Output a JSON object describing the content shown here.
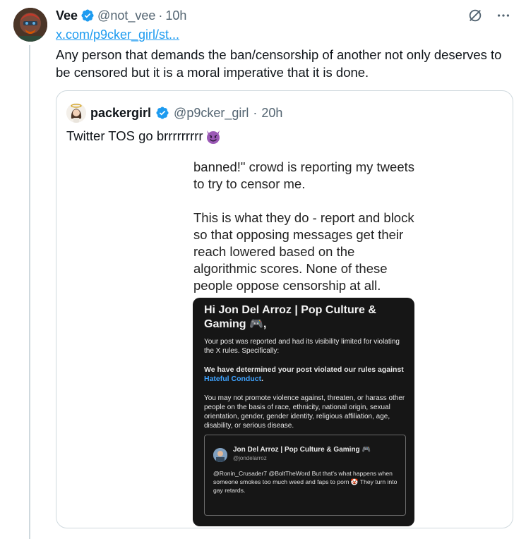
{
  "post": {
    "author_name": "Vee",
    "author_handle": "@not_vee",
    "separator": "·",
    "time": "10h",
    "link_text": "x.com/p9cker_girl/st...",
    "text": "Any person that demands the ban/censorship of another not only deserves to be censored but it is a moral imperative that it is done."
  },
  "quote": {
    "author_name": "packergirl",
    "author_handle": "@p9cker_girl",
    "separator": "·",
    "time": "20h",
    "text": "Twitter TOS go brrrrrrrrr",
    "media": {
      "paragraph1": "banned!\" crowd is reporting my tweets to try to censor me.",
      "paragraph2": "This is what they do - report and block so that opposing messages get their reach lowered based on the algorithmic scores. None of these people oppose censorship at all.",
      "notice": {
        "title": "Hi Jon Del Arroz | Pop Culture & Gaming 🎮,",
        "line1": "Your post was reported and had its visibility limited for violating the X rules. Specifically:",
        "line2_pre": "We have determined your post violated our rules against ",
        "line2_link": "Hateful Conduct",
        "line2_post": ".",
        "line3": "You may not promote violence against, threaten, or harass other people on the basis of race, ethnicity, national origin, sexual orientation, gender, gender identity, religious affiliation, age, disability, or serious disease.",
        "inner_tweet": {
          "name": "Jon Del Arroz | Pop Culture & Gaming 🎮",
          "handle": "@jondelarroz",
          "body": "@Ronin_Crusader7 @BoltTheWord But that's what happens when someone smokes too much weed and faps to porn 🤡 They turn into gay retards."
        }
      }
    }
  },
  "icons": {
    "verified": "verified-badge-icon",
    "grok": "grok-icon",
    "more": "more-icon",
    "devil": "smiling-devil-emoji"
  },
  "colors": {
    "link": "#1d9bf0",
    "muted": "#536471",
    "border": "#cfd9de"
  }
}
